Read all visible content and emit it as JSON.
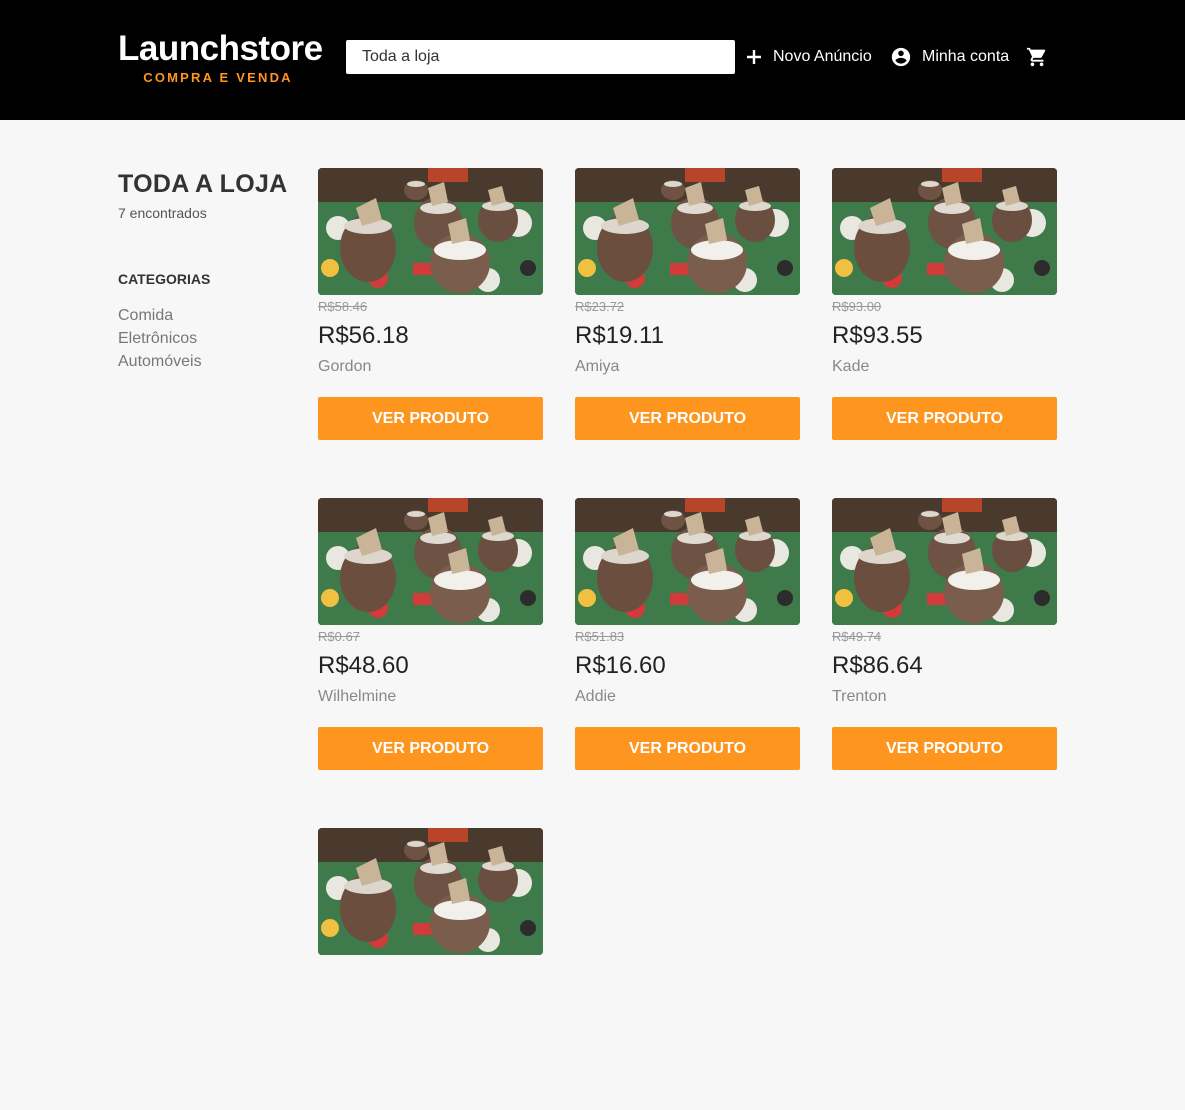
{
  "header": {
    "logo_title": "Launchstore",
    "logo_subtitle": "COMPRA E VENDA",
    "search_placeholder": "Toda a loja",
    "new_ad_label": "Novo Anúncio",
    "account_label": "Minha conta",
    "icons": {
      "new_ad": "plus-icon",
      "account": "account-circle-icon",
      "cart": "shopping-cart-icon"
    }
  },
  "sidebar": {
    "title": "TODA A LOJA",
    "count": "7 encontrados",
    "categories_title": "CATEGORIAS",
    "categories": [
      "Comida",
      "Eletrônicos",
      "Automóveis"
    ]
  },
  "products": [
    {
      "old_price": "R$58.46",
      "price": "R$56.18",
      "seller": "Gordon",
      "button": "VER PRODUTO"
    },
    {
      "old_price": "R$23.72",
      "price": "R$19.11",
      "seller": "Amiya",
      "button": "VER PRODUTO"
    },
    {
      "old_price": "R$93.00",
      "price": "R$93.55",
      "seller": "Kade",
      "button": "VER PRODUTO"
    },
    {
      "old_price": "R$0.67",
      "price": "R$48.60",
      "seller": "Wilhelmine",
      "button": "VER PRODUTO"
    },
    {
      "old_price": "R$51.83",
      "price": "R$16.60",
      "seller": "Addie",
      "button": "VER PRODUTO"
    },
    {
      "old_price": "R$49.74",
      "price": "R$86.64",
      "seller": "Trenton",
      "button": "VER PRODUTO"
    },
    {
      "old_price": "",
      "price": "",
      "seller": "",
      "button": ""
    }
  ],
  "colors": {
    "header_bg": "#000000",
    "accent": "#fd951f",
    "page_bg": "#f7f7f7"
  }
}
